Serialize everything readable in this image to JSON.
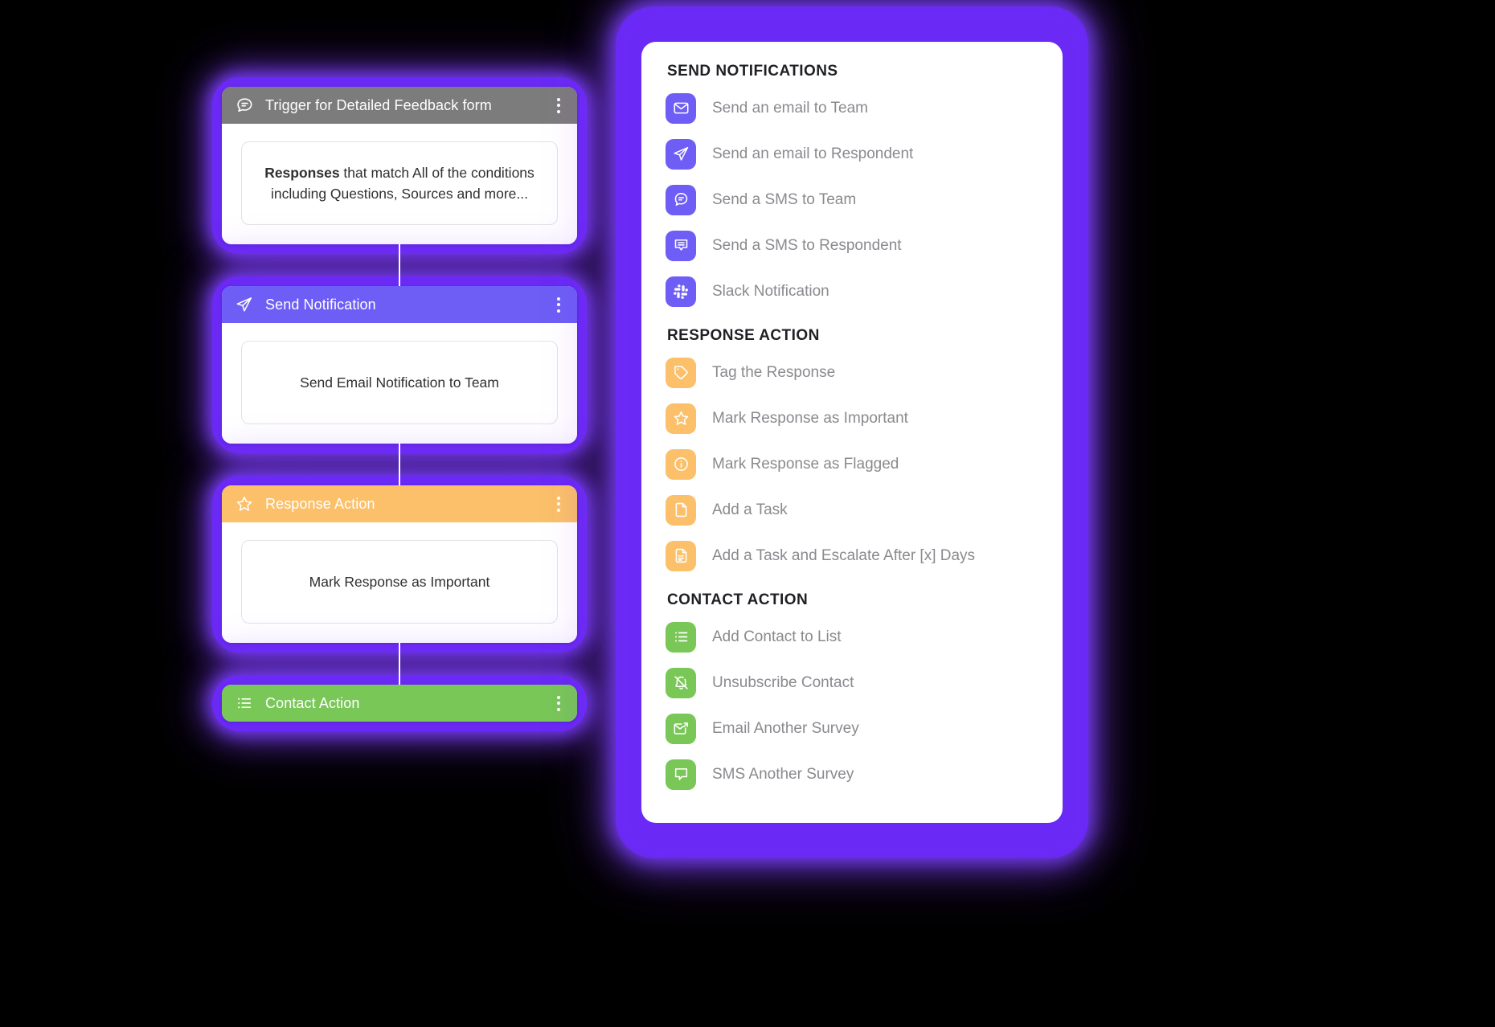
{
  "workflow": {
    "cards": [
      {
        "title": "Trigger for Detailed Feedback form",
        "icon": "chat-bubble-lines-icon",
        "header_color": "#7c7c7c",
        "body_bold": "Responses",
        "body_rest": " that match All of the conditions including Questions, Sources and more...",
        "menu": "kebab-menu-icon"
      },
      {
        "title": "Send Notification",
        "icon": "paper-plane-icon",
        "header_color": "#6e5ef5",
        "body_bold": "",
        "body_rest": "Send Email Notification to Team",
        "menu": "kebab-menu-icon"
      },
      {
        "title": "Response Action",
        "icon": "star-icon",
        "header_color": "#fbc069",
        "body_bold": "",
        "body_rest": "Mark Response as Important",
        "menu": "kebab-menu-icon"
      },
      {
        "title": "Contact Action",
        "icon": "list-icon",
        "header_color": "#78c757",
        "body_bold": "",
        "body_rest": "",
        "menu": "kebab-menu-icon"
      }
    ]
  },
  "palette": {
    "sections": [
      {
        "title": "SEND NOTIFICATIONS",
        "tile_color": "#6e5ef5",
        "items": [
          {
            "label": "Send an email to Team",
            "icon": "envelope-icon"
          },
          {
            "label": "Send an email to Respondent",
            "icon": "paper-plane-icon"
          },
          {
            "label": "Send a SMS to Team",
            "icon": "chat-bubble-lines-icon"
          },
          {
            "label": "Send a SMS to Respondent",
            "icon": "message-square-lines-icon"
          },
          {
            "label": "Slack Notification",
            "icon": "slack-icon"
          }
        ]
      },
      {
        "title": "RESPONSE ACTION",
        "tile_color": "#fbc069",
        "items": [
          {
            "label": "Tag the Response",
            "icon": "tag-icon"
          },
          {
            "label": "Mark Response as Important",
            "icon": "star-icon"
          },
          {
            "label": "Mark Response as Flagged",
            "icon": "info-circle-icon"
          },
          {
            "label": "Add a Task",
            "icon": "file-blank-icon"
          },
          {
            "label": "Add a Task and Escalate After [x] Days",
            "icon": "file-lines-icon"
          }
        ]
      },
      {
        "title": "CONTACT ACTION",
        "tile_color": "#78c757",
        "items": [
          {
            "label": "Add Contact to List",
            "icon": "list-icon"
          },
          {
            "label": "Unsubscribe Contact",
            "icon": "bell-slash-icon"
          },
          {
            "label": "Email Another Survey",
            "icon": "envelope-arrow-icon"
          },
          {
            "label": "SMS Another Survey",
            "icon": "message-square-icon"
          }
        ]
      }
    ]
  },
  "colors": {
    "glow": "#6a29f5",
    "purple": "#6e5ef5",
    "orange": "#fbc069",
    "green": "#78c757",
    "gray": "#7c7c7c",
    "background": "#000000"
  }
}
